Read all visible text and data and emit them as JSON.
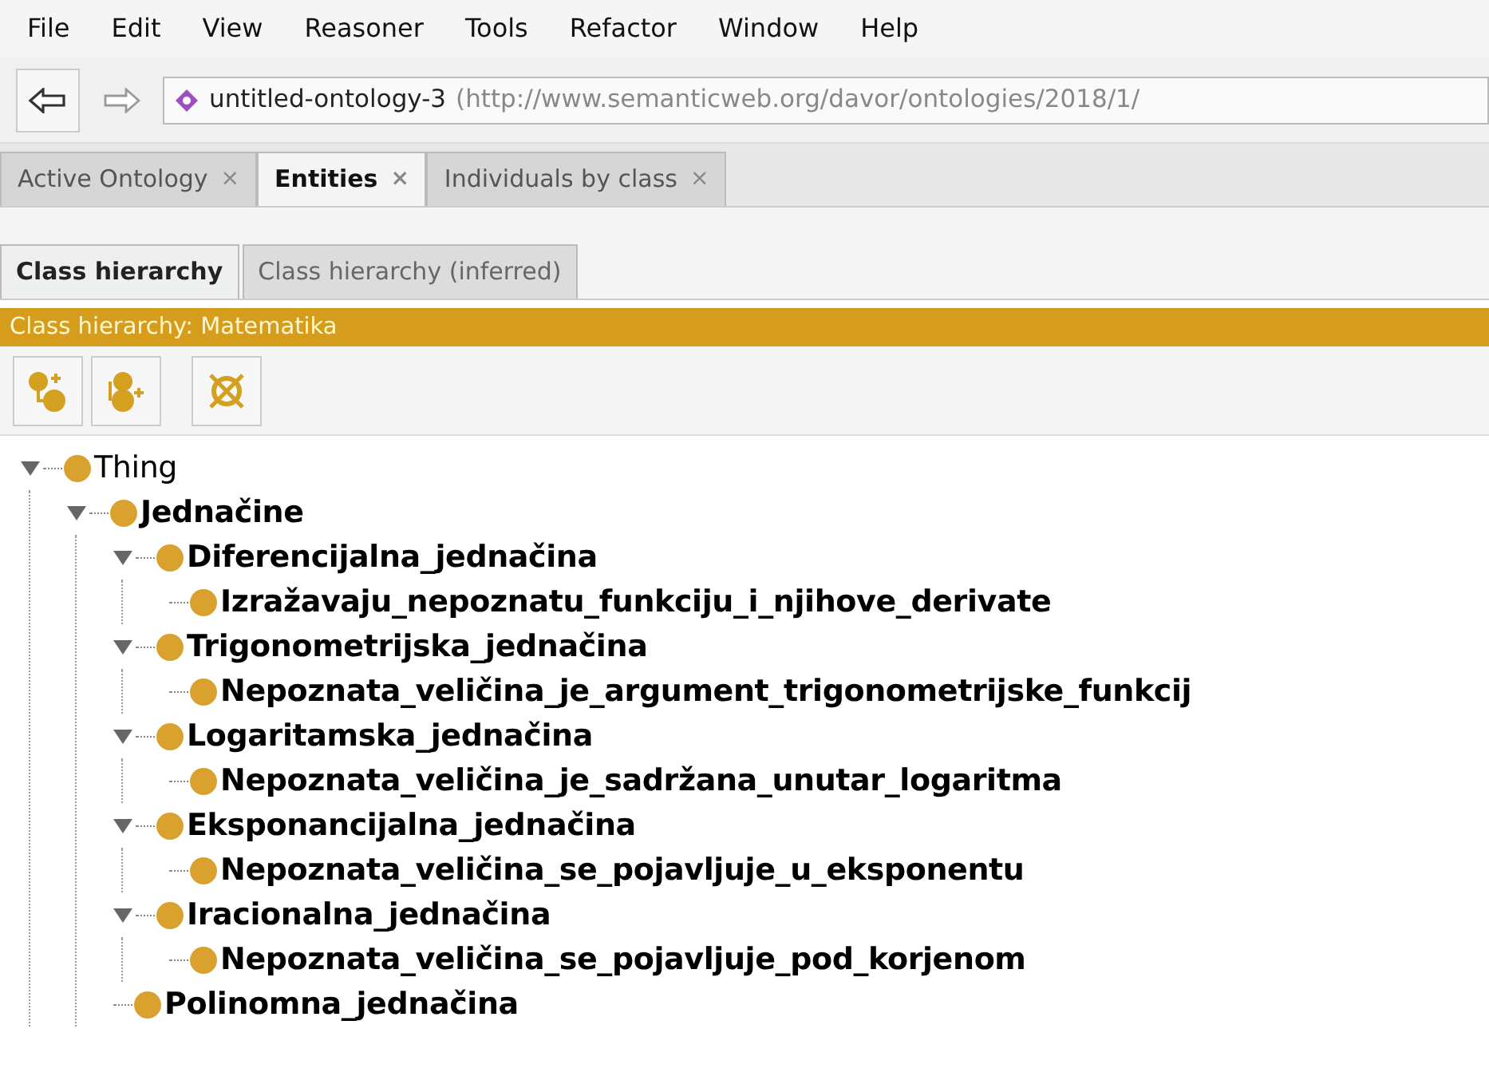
{
  "menu": [
    "File",
    "Edit",
    "View",
    "Reasoner",
    "Tools",
    "Refactor",
    "Window",
    "Help"
  ],
  "address": {
    "name": "untitled-ontology-3",
    "iri": "(http://www.semanticweb.org/davor/ontologies/2018/1/"
  },
  "tabs": [
    {
      "label": "Active Ontology",
      "selected": false,
      "close": "×"
    },
    {
      "label": "Entities",
      "selected": true,
      "close": "×"
    },
    {
      "label": "Individuals by class",
      "selected": false,
      "close": "×"
    }
  ],
  "subtabs": [
    {
      "label": "Class hierarchy",
      "selected": true
    },
    {
      "label": "Class hierarchy (inferred)",
      "selected": false
    }
  ],
  "panel_title": "Class hierarchy: Matematika",
  "tree": [
    {
      "label": "Thing",
      "expanded": true,
      "children": [
        {
          "label": "Jednačine",
          "expanded": true,
          "children": [
            {
              "label": "Diferencijalna_jednačina",
              "expanded": true,
              "children": [
                {
                  "label": "Izražavaju_nepoznatu_funkciju_i_njihove_derivate"
                }
              ]
            },
            {
              "label": "Trigonometrijska_jednačina",
              "expanded": true,
              "children": [
                {
                  "label": "Nepoznata_veličina_je_argument_trigonometrijske_funkcij"
                }
              ]
            },
            {
              "label": "Logaritamska_jednačina",
              "expanded": true,
              "children": [
                {
                  "label": "Nepoznata_veličina_je_sadržana_unutar_logaritma"
                }
              ]
            },
            {
              "label": "Eksponancijalna_jednačina",
              "expanded": true,
              "children": [
                {
                  "label": "Nepoznata_veličina_se_pojavljuje_u_eksponentu"
                }
              ]
            },
            {
              "label": "Iracionalna_jednačina",
              "expanded": true,
              "children": [
                {
                  "label": "Nepoznata_veličina_se_pojavljuje_pod_korjenom"
                }
              ]
            },
            {
              "label": "Polinomna_jednačina"
            }
          ]
        }
      ]
    }
  ]
}
